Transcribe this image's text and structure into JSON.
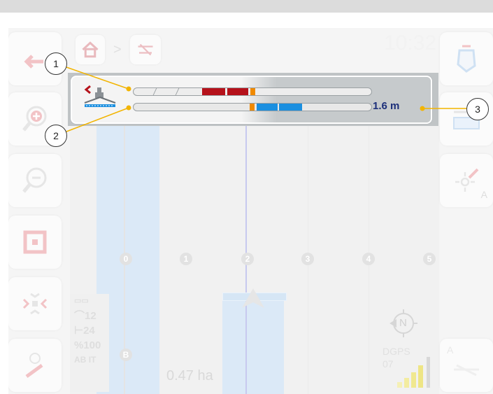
{
  "header": {
    "clock": "10:32",
    "breadcrumb": {
      "home_icon": "home-icon",
      "separator": ">",
      "implement_icon": "implement-icon"
    }
  },
  "left_toolbar": [
    {
      "name": "back-button",
      "icon": "back-icon"
    },
    {
      "name": "zoom-in-button",
      "icon": "zoom-in-icon"
    },
    {
      "name": "zoom-out-button",
      "icon": "zoom-out-icon"
    },
    {
      "name": "view-mode-button",
      "icon": "view-square-icon"
    },
    {
      "name": "reset-guidance-button",
      "icon": "satellite-icon"
    },
    {
      "name": "settings-button",
      "icon": "wrench-icon"
    }
  ],
  "right_toolbar": [
    {
      "name": "field-boundary-button",
      "icon": "field-boundary-icon"
    },
    {
      "name": "headland-button",
      "icon": "headland-icon"
    },
    {
      "name": "set-point-a-button",
      "icon": "point-a-icon",
      "label": "A"
    },
    {
      "name": "auto-steer-button",
      "icon": "auto-steer-icon",
      "label": "A"
    }
  ],
  "map": {
    "lane_numbers": [
      "0",
      "1",
      "2",
      "3",
      "4",
      "5"
    ],
    "marker_b": "B",
    "area": "0.47 ha",
    "compass": "N",
    "gps_mode": "DGPS",
    "satellites": "07"
  },
  "stats_panel": {
    "rows": [
      "12",
      "24",
      "100",
      "IT"
    ],
    "prefixes": [
      "",
      "",
      "%",
      "AB"
    ]
  },
  "lightbar": {
    "distance": "1.6 m",
    "steer_direction": "left",
    "colors": {
      "red": "#b5121b",
      "orange": "#f08a00",
      "blue": "#1a8fe0",
      "text": "#1c2f7a"
    }
  },
  "callouts": [
    "1",
    "2",
    "3"
  ]
}
